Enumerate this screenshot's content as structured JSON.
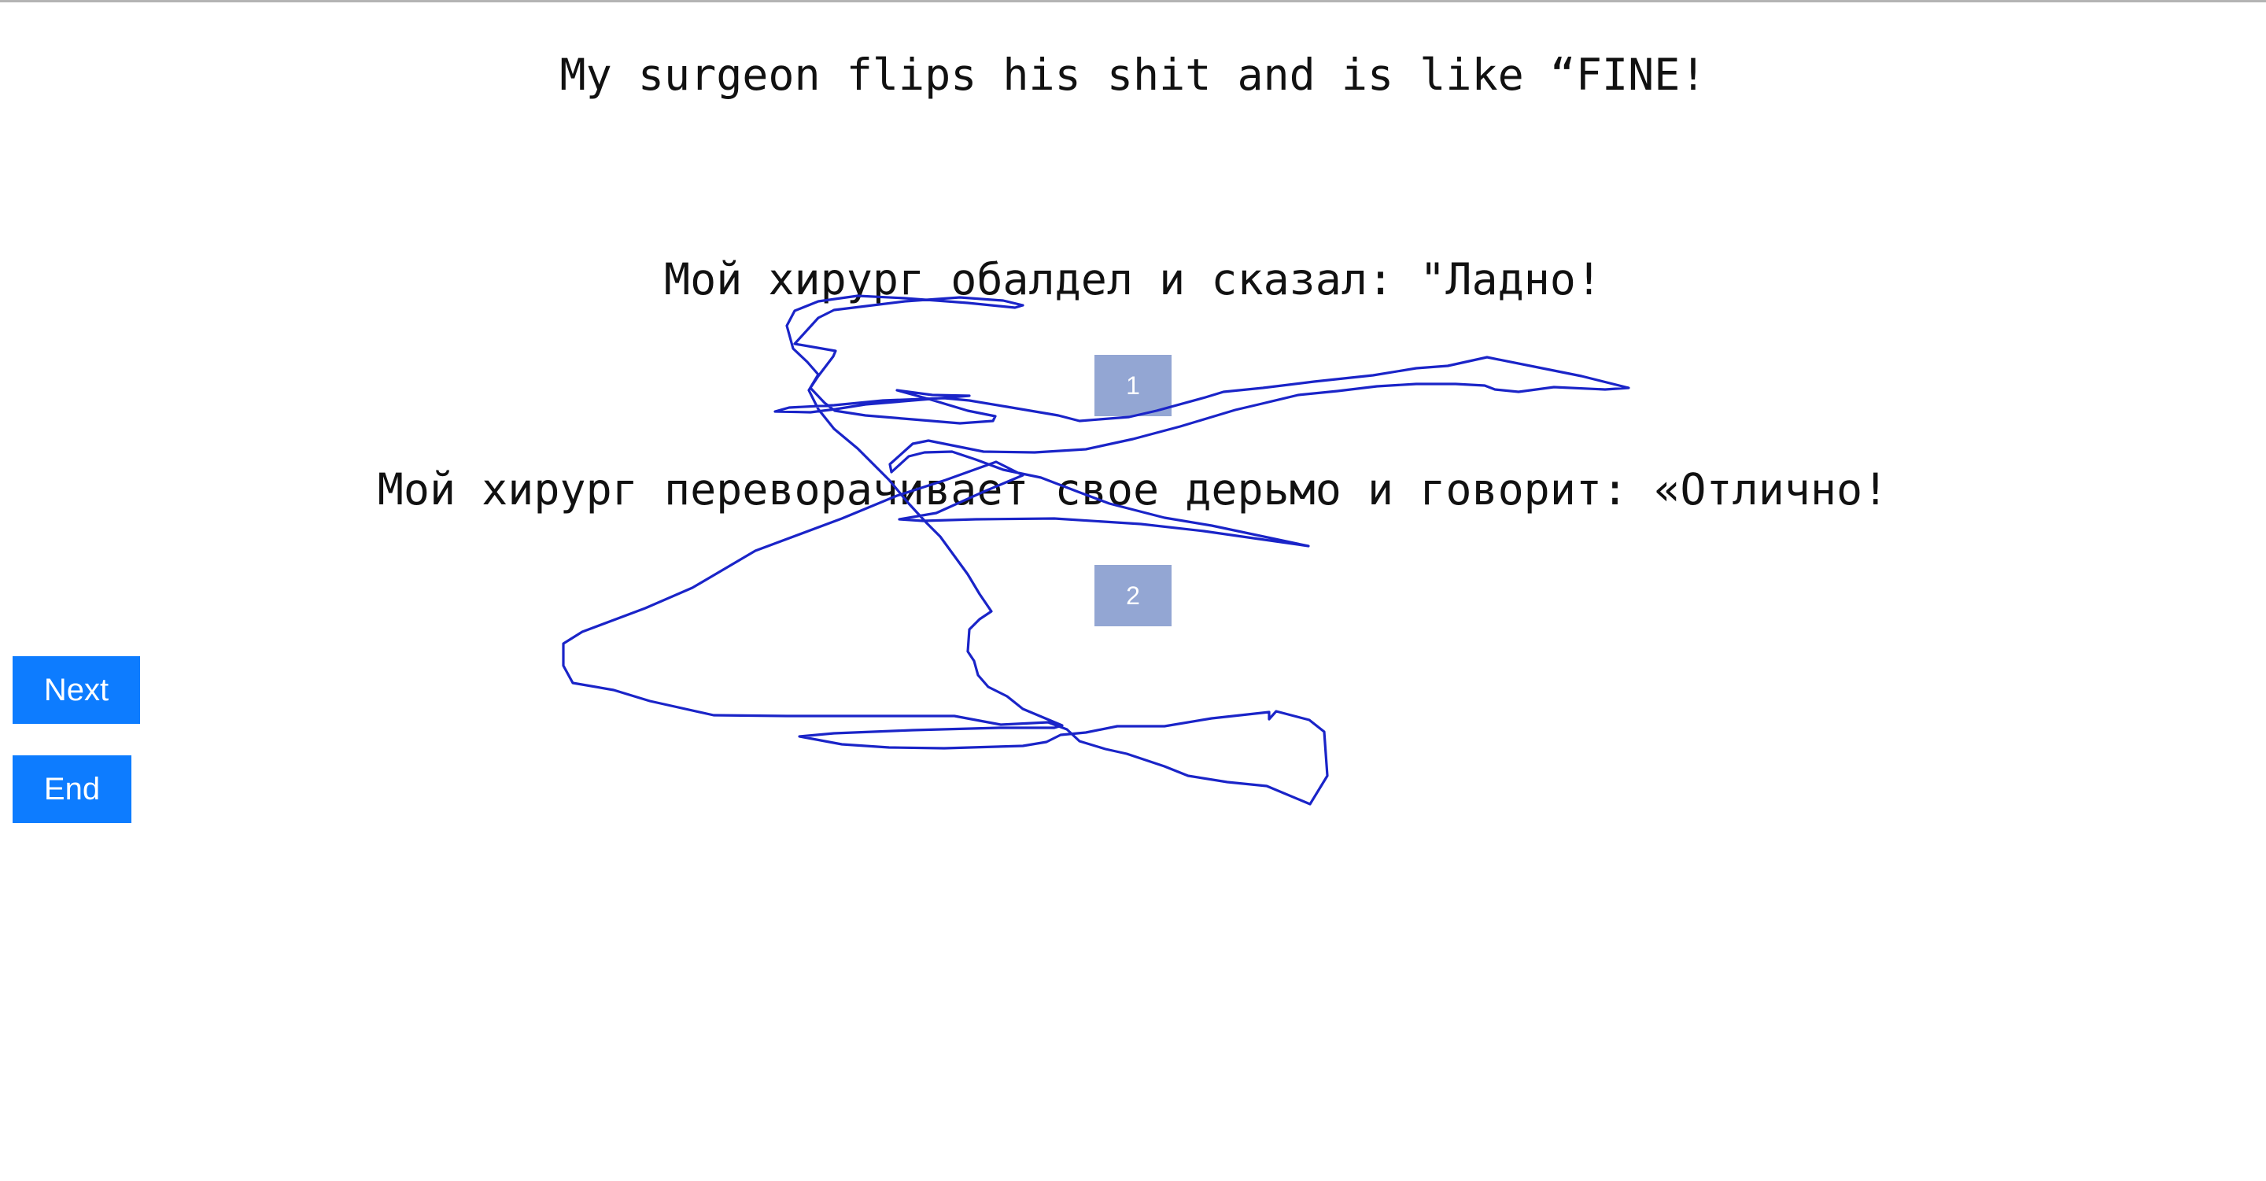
{
  "source_text": "My surgeon flips his shit and is like “FINE!",
  "translations": [
    {
      "text": "Мой хирург обалдел и сказал: \"Ладно!",
      "choice_label": "1"
    },
    {
      "text": "Мой хирург переворачивает свое дерьмо и говорит: «Отлично!",
      "choice_label": "2"
    }
  ],
  "nav": {
    "next_label": "Next",
    "end_label": "End"
  },
  "colors": {
    "choice_button": "#93a6d3",
    "nav_button": "#0d7cff",
    "scribble_stroke": "#1a24c8"
  }
}
